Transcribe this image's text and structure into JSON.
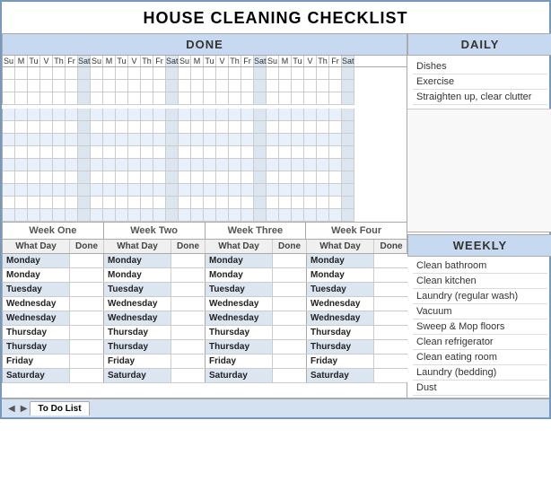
{
  "title": "HOUSE CLEANING CHECKLIST",
  "done_header": "DONE",
  "daily_header": "DAILY",
  "weekly_header": "WEEKLY",
  "days": [
    "Su",
    "M",
    "Tu",
    "V",
    "Th",
    "Fr",
    "Sat",
    "Su",
    "M",
    "Tu",
    "V",
    "Th",
    "Fr",
    "Sat",
    "Su",
    "M",
    "Tu",
    "V",
    "Th",
    "Fr",
    "Sat",
    "Su",
    "M",
    "Tu",
    "V",
    "Th",
    "Fr",
    "Sat"
  ],
  "grid_rows": 13,
  "daily_tasks": [
    "Dishes",
    "Exercise",
    "Straighten up, clear clutter"
  ],
  "weekly_tasks": [
    "Clean bathroom",
    "Clean kitchen",
    "Laundry (regular wash)",
    "Vacuum",
    "Sweep & Mop floors",
    "Clean refrigerator",
    "Clean eating room",
    "Laundry (bedding)",
    "Dust"
  ],
  "week_headers": [
    "Week One",
    "Week Two",
    "Week Three",
    "Week Four"
  ],
  "col_labels": [
    "What Day",
    "Done",
    "What Day",
    "Done",
    "What Day",
    "Done",
    "What Day",
    "Done"
  ],
  "schedule_rows": [
    {
      "days": [
        "Monday",
        "Monday",
        "Monday",
        "Monday"
      ],
      "color": "blue"
    },
    {
      "days": [
        "Monday",
        "Monday",
        "Monday",
        "Monday"
      ],
      "color": "white"
    },
    {
      "days": [
        "Tuesday",
        "Tuesday",
        "Tuesday",
        "Tuesday"
      ],
      "color": "blue"
    },
    {
      "days": [
        "Wednesday",
        "Wednesday",
        "Wednesday",
        "Wednesday"
      ],
      "color": "white"
    },
    {
      "days": [
        "Wednesday",
        "Wednesday",
        "Wednesday",
        "Wednesday"
      ],
      "color": "blue"
    },
    {
      "days": [
        "Thursday",
        "Thursday",
        "Thursday",
        "Thursday"
      ],
      "color": "white"
    },
    {
      "days": [
        "Thursday",
        "Thursday",
        "Thursday",
        "Thursday"
      ],
      "color": "blue"
    },
    {
      "days": [
        "Friday",
        "Friday",
        "Friday",
        "Friday"
      ],
      "color": "white"
    },
    {
      "days": [
        "Saturday",
        "Saturday",
        "Saturday",
        "Saturday"
      ],
      "color": "blue"
    }
  ],
  "tabs": [
    {
      "label": "To Do List",
      "active": true
    }
  ],
  "done_col_text": "Done",
  "what_day_text": "What Day"
}
